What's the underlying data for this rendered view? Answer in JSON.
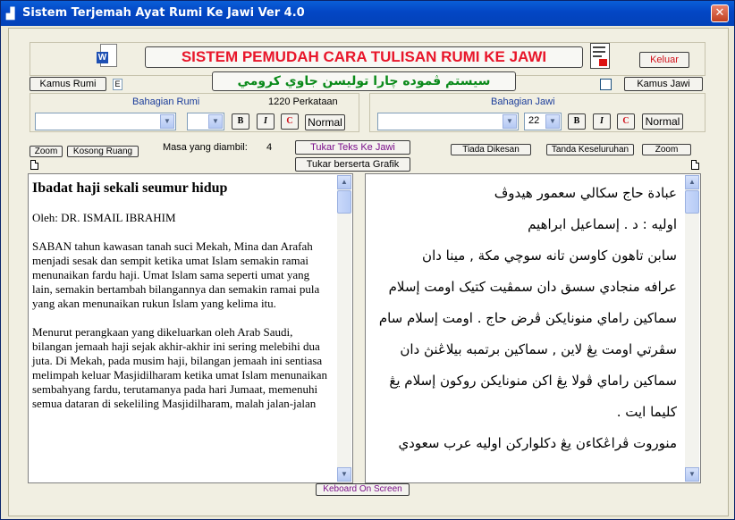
{
  "window": {
    "title": "Sistem Terjemah Ayat Rumi Ke Jawi  Ver 4.0",
    "close_glyph": "✕"
  },
  "header": {
    "banner_rumi": "SISTEM PEMUDAH CARA TULISAN RUMI KE JAWI",
    "banner_jawi": "سيستم  ڤموده چارا توليسن جاوي كرومي",
    "keluar_label": "Keluar",
    "banner_color": "#e8162a",
    "jawi_color": "#0a8a1a"
  },
  "kamus": {
    "rumi_label": "Kamus Rumi",
    "rumi_indicator": "E",
    "jawi_label": "Kamus Jawi"
  },
  "rumi_panel": {
    "title": "Bahagian Rumi",
    "word_count": "1220 Perkataan",
    "font_value": "",
    "size_value": "",
    "bold": "B",
    "italic": "I",
    "color": "C",
    "normal_label": "Normal"
  },
  "jawi_panel": {
    "title": "Bahagian Jawi",
    "font_value": "",
    "size_value": "22",
    "bold": "B",
    "italic": "I",
    "color": "C",
    "normal_label": "Normal"
  },
  "actions": {
    "zoom_left": "Zoom",
    "kosong_ruang": "Kosong Ruang",
    "masa_label": "Masa yang diambil:",
    "masa_value": "4",
    "tukar_teks": "Tukar Teks Ke Jawi",
    "tukar_grafik": "Tukar berserta Grafik",
    "tiada_dikesan": "Tiada Dikesan",
    "tanda_keseluruhan": "Tanda Keseluruhan",
    "zoom_right": "Zoom",
    "keyboard": "Keboard  On Screen"
  },
  "rumi_doc": {
    "heading": "Ibadat haji sekali seumur hidup",
    "author": "Oleh: DR. ISMAIL IBRAHIM",
    "p1": "SABAN tahun kawasan tanah suci Mekah, Mina dan Arafah menjadi sesak dan sempit ketika umat Islam semakin ramai menunaikan fardu haji. Umat Islam sama seperti umat yang lain, semakin bertambah bilangannya dan semakin ramai pula yang akan menunaikan rukun Islam yang kelima itu.",
    "p2": "Menurut perangkaan yang dikeluarkan oleh Arab Saudi, bilangan jemaah haji sejak akhir-akhir ini sering melebihi dua juta. Di Mekah, pada musim haji, bilangan jemaah ini sentiasa melimpah keluar Masjidilharam ketika umat Islam menunaikan sembahyang fardu, terutamanya pada hari Jumaat, memenuhi semua dataran di sekeliling Masjidilharam, malah jalan-jalan"
  },
  "jawi_doc": {
    "lines": [
      "عبادة حاج سكالي سعمور هيدوڤ",
      "اوليه : د . إسماعيل ابراهيم",
      "سابن تاهون كاوسن تانه سوچي مكة , مينا دان",
      "عرافه منجادي سسق دان سمڤيت كتيک اومت إسلام",
      "سماکين راماي منونايکن ڤرض حاج . اومت إسلام سام",
      "سڤرتي اومت يڠ لاين , سماکين برتمبه بيلاڠنڽ دان",
      "سماکين راماي ڤولا يڠ اکن منونايکن روکون إسلام يڠ",
      "كليما ايت .",
      "منوروت ڤراڠكاءن يڠ دكلواركن اوليه عرب سعودي"
    ]
  }
}
